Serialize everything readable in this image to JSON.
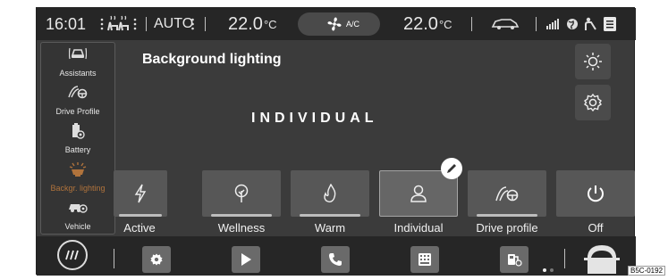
{
  "status_bar": {
    "time": "16:01",
    "climate_mode": "AUTO",
    "temp_left": "22.0",
    "temp_left_unit": "°C",
    "ac_label": "A/C",
    "temp_right": "22.0",
    "temp_right_unit": "°C"
  },
  "sidebar": {
    "items": [
      {
        "label": "Assistants",
        "icon": "assistants-icon"
      },
      {
        "label": "Drive Profile",
        "icon": "drive-profile-icon"
      },
      {
        "label": "Battery",
        "icon": "battery-icon"
      },
      {
        "label": "Backgr. lighting",
        "icon": "background-lighting-icon",
        "active": true
      },
      {
        "label": "Vehicle",
        "icon": "vehicle-icon"
      }
    ]
  },
  "main": {
    "title": "Background lighting",
    "mode": "INDIVIDUAL",
    "tiles": [
      {
        "label": "Active",
        "icon": "lightning-icon"
      },
      {
        "label": "Wellness",
        "icon": "tree-icon"
      },
      {
        "label": "Warm",
        "icon": "flame-icon"
      },
      {
        "label": "Individual",
        "icon": "person-icon",
        "selected": true
      },
      {
        "label": "Drive profile",
        "icon": "drive-profile-icon"
      },
      {
        "label": "Off",
        "icon": "power-icon"
      }
    ]
  },
  "colors": {
    "accent_active": "#b0733c",
    "background": "#3b3b3b",
    "bar": "#262626"
  },
  "figure_code": "B5C-0192"
}
